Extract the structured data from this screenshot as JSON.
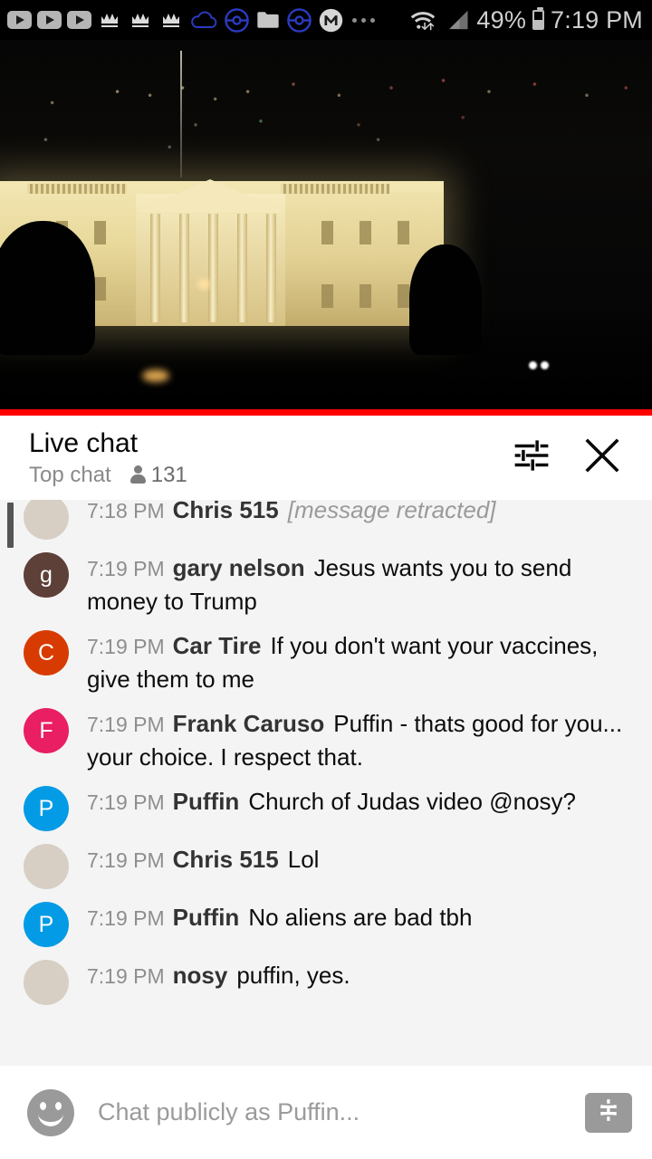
{
  "status_bar": {
    "icons": [
      {
        "name": "youtube-icon",
        "glyph": "play"
      },
      {
        "name": "youtube-icon",
        "glyph": "play"
      },
      {
        "name": "youtube-icon",
        "glyph": "play"
      },
      {
        "name": "crown-icon",
        "glyph": "crown"
      },
      {
        "name": "crown-icon",
        "glyph": "crown"
      },
      {
        "name": "crown-icon",
        "glyph": "crown"
      },
      {
        "name": "cloud-icon",
        "glyph": "cloud"
      },
      {
        "name": "pokeball-icon",
        "glyph": "pokeball"
      },
      {
        "name": "folder-icon",
        "glyph": "folder"
      },
      {
        "name": "pokeball-icon",
        "glyph": "pokeball"
      },
      {
        "name": "mega-icon",
        "glyph": "M"
      },
      {
        "name": "more-notifications-icon",
        "glyph": "dots"
      }
    ],
    "wifi_icon": "wifi-data-icon",
    "signal_icon": "cellular-signal-icon",
    "battery_percent": "49%",
    "battery_icon": "battery-icon",
    "time": "7:19 PM"
  },
  "video": {
    "description": "White House at night",
    "progress_percent": 100,
    "progress_color": "#ff0000"
  },
  "chat_header": {
    "title": "Live chat",
    "mode": "Top chat",
    "viewer_icon": "person-icon",
    "viewer_count": "131",
    "settings_icon": "tune-icon",
    "close_icon": "close-icon"
  },
  "messages": [
    {
      "time": "7:18 PM",
      "author": "Chris 515",
      "text": "[message retracted]",
      "retracted": true,
      "avatar_type": "photo",
      "avatar_class": "ph-chris",
      "avatar_letter": "",
      "avatar_color": ""
    },
    {
      "time": "7:19 PM",
      "author": "gary nelson",
      "text": "Jesus wants you to send money to Trump",
      "retracted": false,
      "avatar_type": "letter",
      "avatar_class": "",
      "avatar_letter": "g",
      "avatar_color": "#5d4037"
    },
    {
      "time": "7:19 PM",
      "author": "Car Tire",
      "text": "If you don't want your vaccines, give them to me",
      "retracted": false,
      "avatar_type": "letter",
      "avatar_class": "",
      "avatar_letter": "C",
      "avatar_color": "#d83b01"
    },
    {
      "time": "7:19 PM",
      "author": "Frank Caruso",
      "text": "Puffin - thats good for you... your choice. I respect that.",
      "retracted": false,
      "avatar_type": "letter",
      "avatar_class": "",
      "avatar_letter": "F",
      "avatar_color": "#e91e63"
    },
    {
      "time": "7:19 PM",
      "author": "Puffin",
      "text": "Church of Judas video @nosy?",
      "retracted": false,
      "avatar_type": "letter",
      "avatar_class": "",
      "avatar_letter": "P",
      "avatar_color": "#039be5"
    },
    {
      "time": "7:19 PM",
      "author": "Chris 515",
      "text": "Lol",
      "retracted": false,
      "avatar_type": "photo",
      "avatar_class": "ph-chris",
      "avatar_letter": "",
      "avatar_color": ""
    },
    {
      "time": "7:19 PM",
      "author": "Puffin",
      "text": "No aliens are bad tbh",
      "retracted": false,
      "avatar_type": "letter",
      "avatar_class": "",
      "avatar_letter": "P",
      "avatar_color": "#039be5"
    },
    {
      "time": "7:19 PM",
      "author": "nosy",
      "text": "puffin, yes.",
      "retracted": false,
      "avatar_type": "photo",
      "avatar_class": "ph-nosy",
      "avatar_letter": "",
      "avatar_color": ""
    }
  ],
  "input_bar": {
    "emoji_icon": "emoji-icon",
    "placeholder": "Chat publicly as Puffin...",
    "value": "",
    "superchat_icon": "dollar-icon"
  }
}
